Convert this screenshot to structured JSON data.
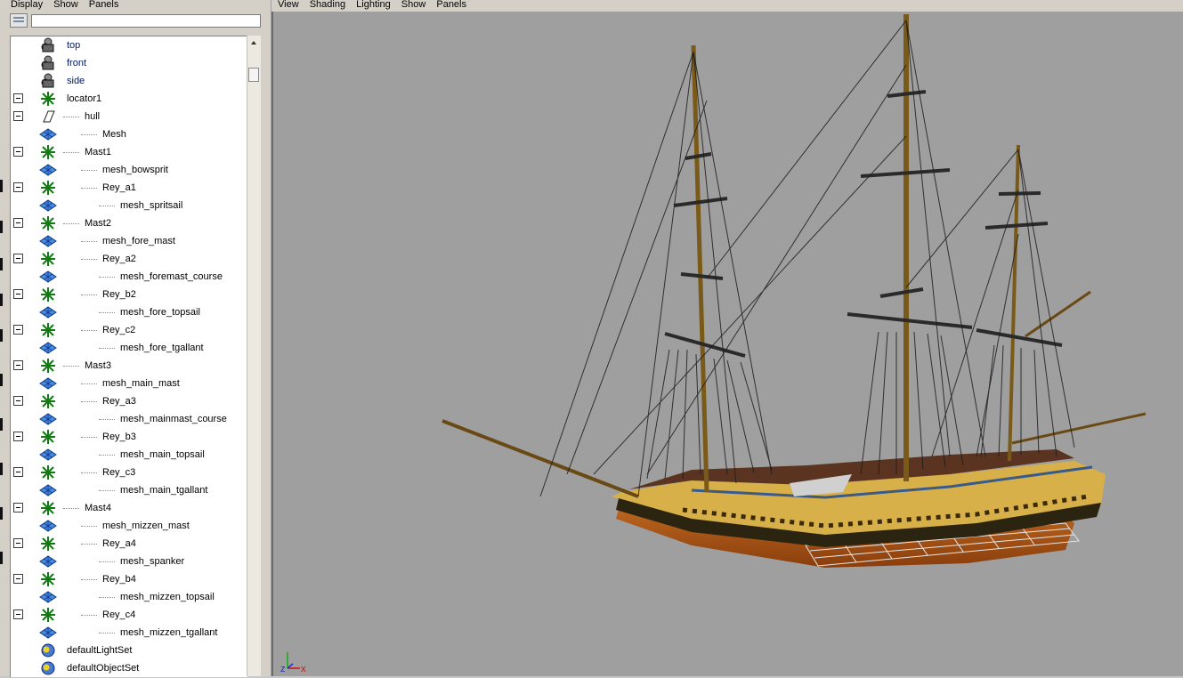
{
  "outliner": {
    "menu": [
      "Display",
      "Show",
      "Panels"
    ],
    "search": {
      "value": "",
      "placeholder": ""
    },
    "items": [
      {
        "label": "top",
        "icon": "camera-icon",
        "depth": 0,
        "toggle": false,
        "blue": true
      },
      {
        "label": "front",
        "icon": "camera-icon",
        "depth": 0,
        "toggle": false,
        "blue": true
      },
      {
        "label": "side",
        "icon": "camera-icon",
        "depth": 0,
        "toggle": false,
        "blue": true
      },
      {
        "label": "locator1",
        "icon": "locator-icon",
        "depth": 0,
        "toggle": true,
        "blue": false
      },
      {
        "label": "hull",
        "icon": "transform-icon",
        "depth": 1,
        "toggle": true,
        "blue": false
      },
      {
        "label": "Mesh",
        "icon": "mesh-icon",
        "depth": 2,
        "toggle": false,
        "blue": false
      },
      {
        "label": "Mast1",
        "icon": "locator-icon",
        "depth": 1,
        "toggle": true,
        "blue": false
      },
      {
        "label": "mesh_bowsprit",
        "icon": "mesh-icon",
        "depth": 2,
        "toggle": false,
        "blue": false
      },
      {
        "label": "Rey_a1",
        "icon": "locator-icon",
        "depth": 2,
        "toggle": true,
        "blue": false
      },
      {
        "label": "mesh_spritsail",
        "icon": "mesh-icon",
        "depth": 3,
        "toggle": false,
        "blue": false
      },
      {
        "label": "Mast2",
        "icon": "locator-icon",
        "depth": 1,
        "toggle": true,
        "blue": false
      },
      {
        "label": "mesh_fore_mast",
        "icon": "mesh-icon",
        "depth": 2,
        "toggle": false,
        "blue": false
      },
      {
        "label": "Rey_a2",
        "icon": "locator-icon",
        "depth": 2,
        "toggle": true,
        "blue": false
      },
      {
        "label": "mesh_foremast_course",
        "icon": "mesh-icon",
        "depth": 3,
        "toggle": false,
        "blue": false
      },
      {
        "label": "Rey_b2",
        "icon": "locator-icon",
        "depth": 2,
        "toggle": true,
        "blue": false
      },
      {
        "label": "mesh_fore_topsail",
        "icon": "mesh-icon",
        "depth": 3,
        "toggle": false,
        "blue": false
      },
      {
        "label": "Rey_c2",
        "icon": "locator-icon",
        "depth": 2,
        "toggle": true,
        "blue": false
      },
      {
        "label": "mesh_fore_tgallant",
        "icon": "mesh-icon",
        "depth": 3,
        "toggle": false,
        "blue": false
      },
      {
        "label": "Mast3",
        "icon": "locator-icon",
        "depth": 1,
        "toggle": true,
        "blue": false
      },
      {
        "label": "mesh_main_mast",
        "icon": "mesh-icon",
        "depth": 2,
        "toggle": false,
        "blue": false
      },
      {
        "label": "Rey_a3",
        "icon": "locator-icon",
        "depth": 2,
        "toggle": true,
        "blue": false
      },
      {
        "label": "mesh_mainmast_course",
        "icon": "mesh-icon",
        "depth": 3,
        "toggle": false,
        "blue": false
      },
      {
        "label": "Rey_b3",
        "icon": "locator-icon",
        "depth": 2,
        "toggle": true,
        "blue": false
      },
      {
        "label": "mesh_main_topsail",
        "icon": "mesh-icon",
        "depth": 3,
        "toggle": false,
        "blue": false
      },
      {
        "label": "Rey_c3",
        "icon": "locator-icon",
        "depth": 2,
        "toggle": true,
        "blue": false
      },
      {
        "label": "mesh_main_tgallant",
        "icon": "mesh-icon",
        "depth": 3,
        "toggle": false,
        "blue": false
      },
      {
        "label": "Mast4",
        "icon": "locator-icon",
        "depth": 1,
        "toggle": true,
        "blue": false
      },
      {
        "label": "mesh_mizzen_mast",
        "icon": "mesh-icon",
        "depth": 2,
        "toggle": false,
        "blue": false
      },
      {
        "label": "Rey_a4",
        "icon": "locator-icon",
        "depth": 2,
        "toggle": true,
        "blue": false
      },
      {
        "label": "mesh_spanker",
        "icon": "mesh-icon",
        "depth": 3,
        "toggle": false,
        "blue": false
      },
      {
        "label": "Rey_b4",
        "icon": "locator-icon",
        "depth": 2,
        "toggle": true,
        "blue": false
      },
      {
        "label": "mesh_mizzen_topsail",
        "icon": "mesh-icon",
        "depth": 3,
        "toggle": false,
        "blue": false
      },
      {
        "label": "Rey_c4",
        "icon": "locator-icon",
        "depth": 2,
        "toggle": true,
        "blue": false
      },
      {
        "label": "mesh_mizzen_tgallant",
        "icon": "mesh-icon",
        "depth": 3,
        "toggle": false,
        "blue": false
      },
      {
        "label": "defaultLightSet",
        "icon": "set-icon",
        "depth": 0,
        "toggle": false,
        "blue": false
      },
      {
        "label": "defaultObjectSet",
        "icon": "set-icon",
        "depth": 0,
        "toggle": false,
        "blue": false
      }
    ]
  },
  "viewport": {
    "menu": [
      "View",
      "Shading",
      "Lighting",
      "Show",
      "Panels"
    ],
    "axis": {
      "z": "z",
      "x": "x"
    },
    "colors": {
      "background": "#9f9f9f",
      "hull_bottom": "#b85e1a",
      "hull_band": "#d8b04a",
      "wood": "#5a4010",
      "rigging": "#1c1c1c",
      "axis_x": "#d01010",
      "axis_y": "#10b010",
      "axis_z": "#2030d0"
    }
  }
}
